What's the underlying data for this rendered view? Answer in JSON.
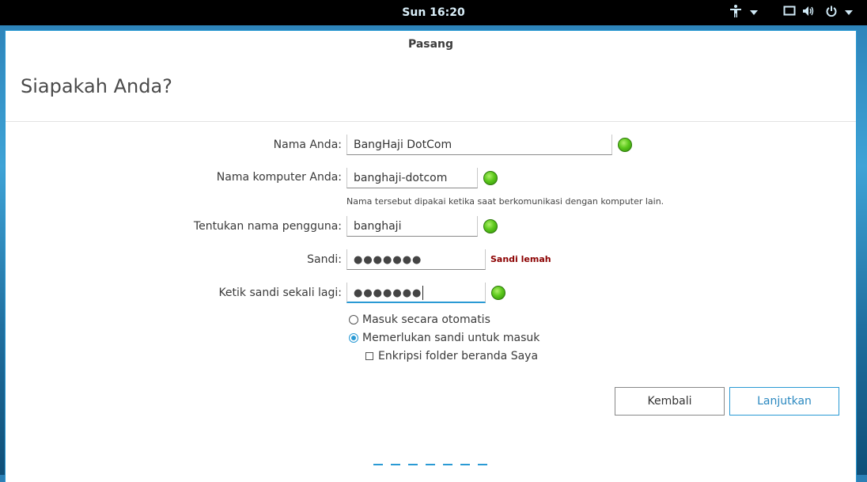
{
  "topbar": {
    "clock": "Sun 16:20",
    "icons": [
      "accessibility-icon",
      "dropdown-icon",
      "screen-icon",
      "volume-icon",
      "power-icon",
      "dropdown-icon"
    ]
  },
  "window": {
    "title": "Pasang",
    "heading": "Siapakah Anda?"
  },
  "form": {
    "name_label": "Nama Anda:",
    "name_value": "BangHaji DotCom",
    "computer_label": "Nama komputer Anda:",
    "computer_value": "banghaji-dotcom",
    "computer_hint": "Nama tersebut dipakai ketika saat berkomunikasi dengan komputer lain.",
    "username_label": "Tentukan nama pengguna:",
    "username_value": "banghaji",
    "password_label": "Sandi:",
    "password_mask": "●●●●●●●",
    "password_strength": "Sandi lemah",
    "confirm_label": "Ketik sandi sekali lagi:",
    "confirm_mask": "●●●●●●●",
    "auto_login_label": "Masuk secara otomatis",
    "require_password_label": "Memerlukan sandi untuk masuk",
    "encrypt_label": "Enkripsi folder beranda Saya",
    "selected_login_option": "Memerlukan sandi untuk masuk",
    "encrypt_checked": false
  },
  "buttons": {
    "back": "Kembali",
    "next": "Lanjutkan"
  },
  "colors": {
    "accent": "#2a9ad4",
    "ok_green": "#5cc81c",
    "weak_red": "#8b0000"
  }
}
